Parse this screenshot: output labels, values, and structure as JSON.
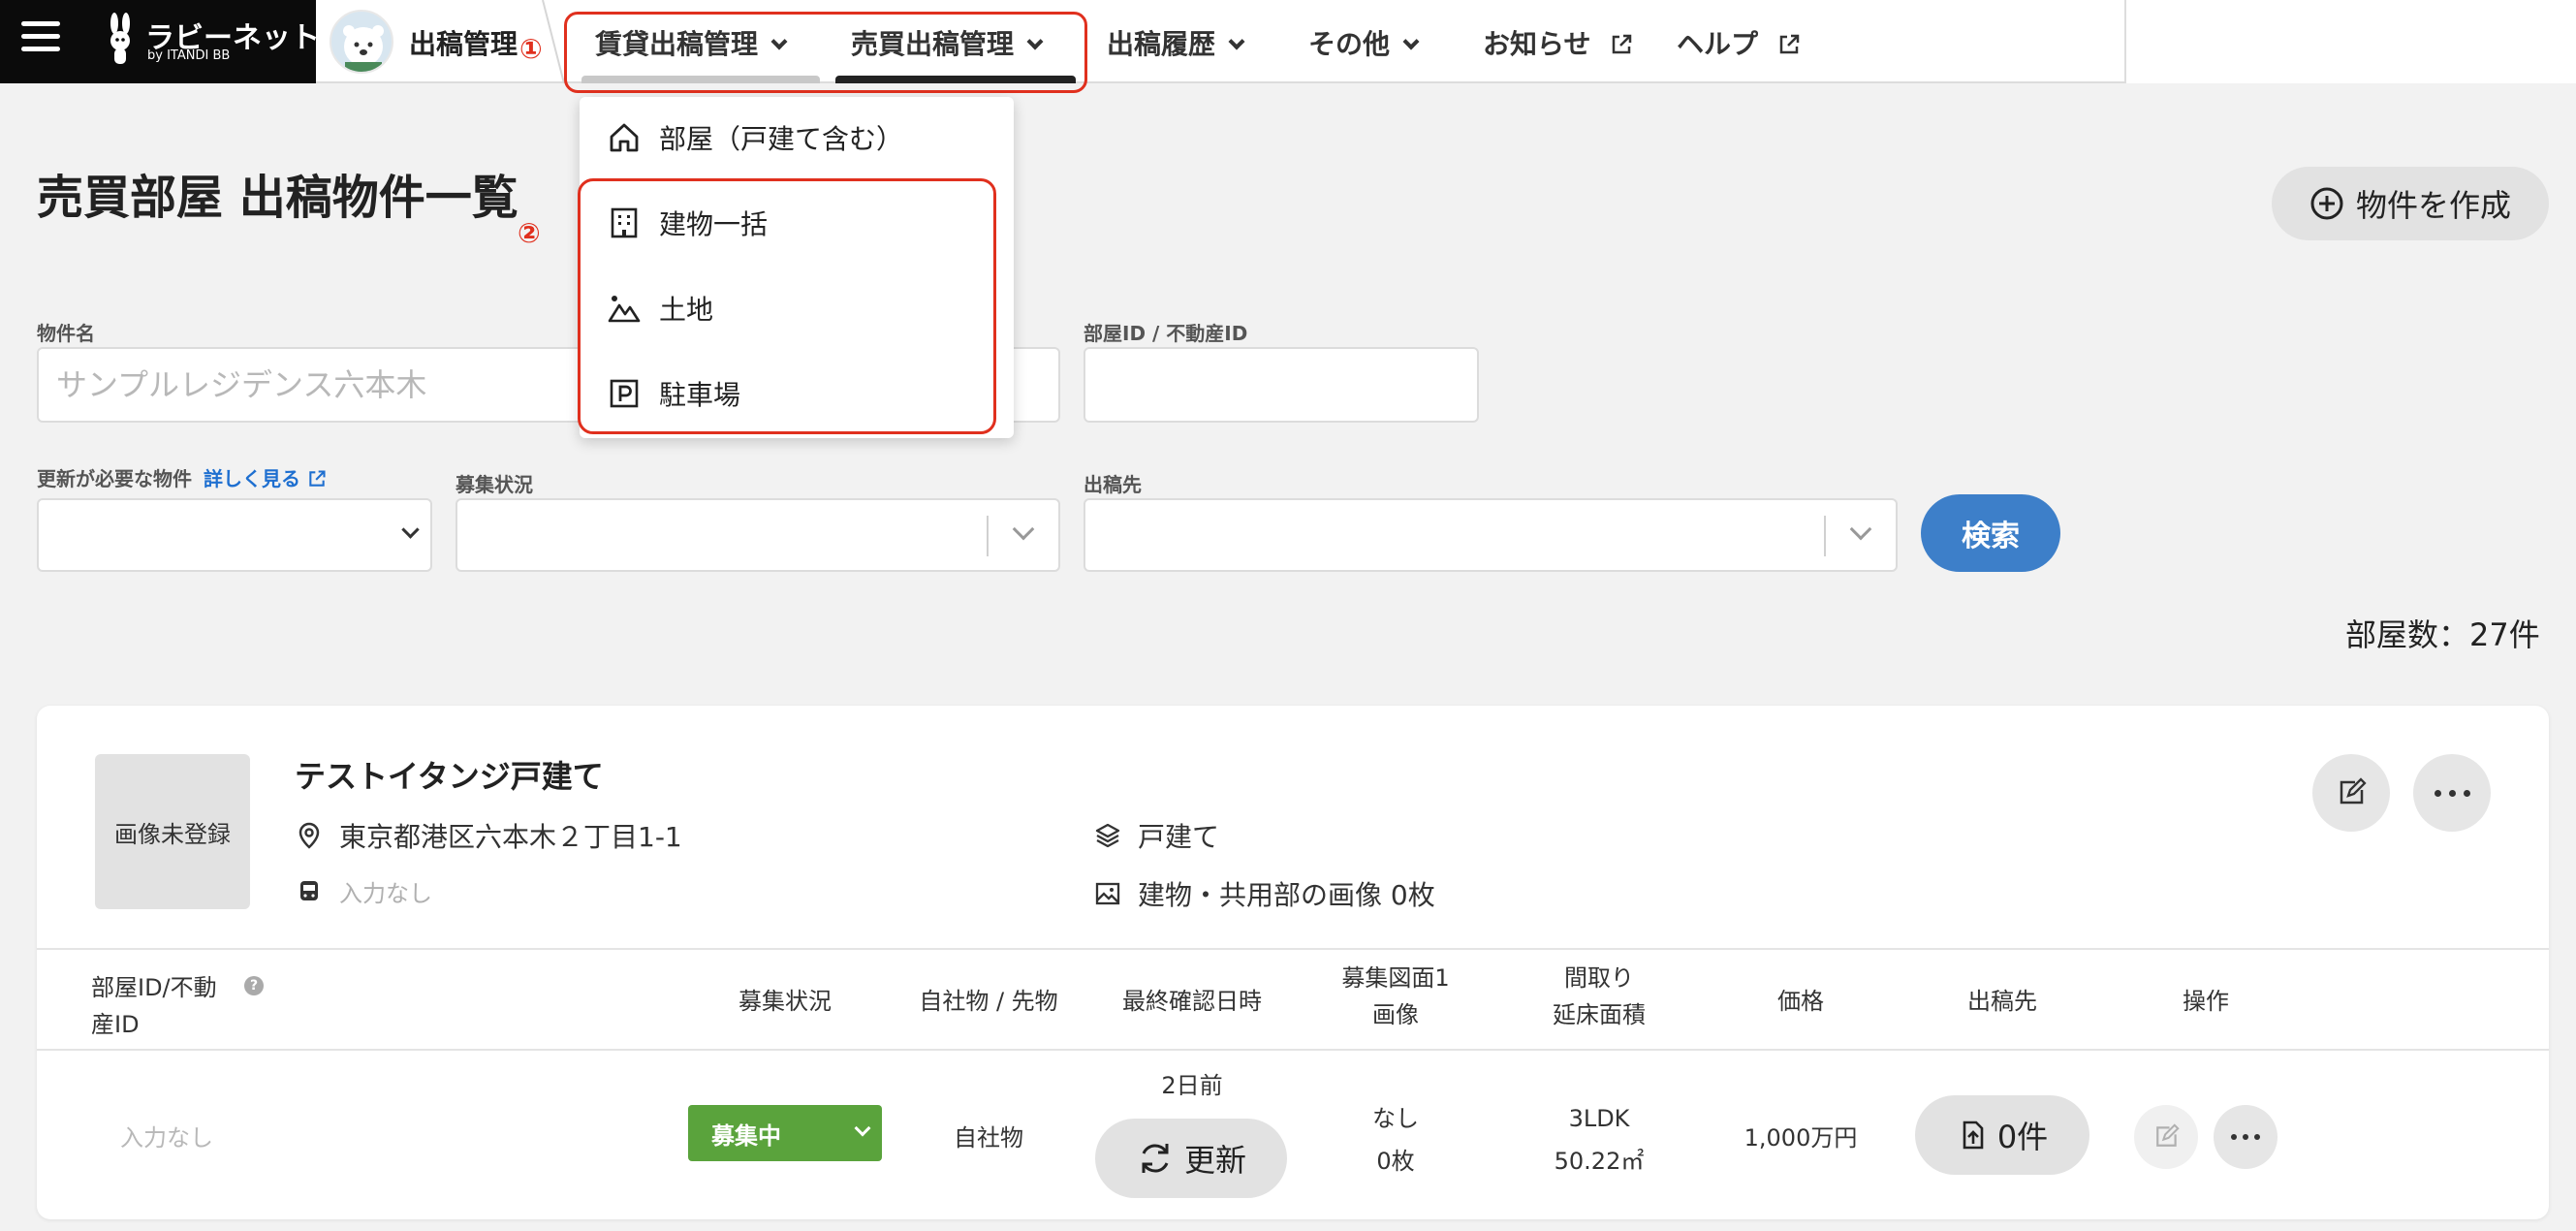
{
  "brand": {
    "name": "ラビーネットBB",
    "sub": "by ITANDI BB"
  },
  "app": {
    "name": "出稿管理"
  },
  "nav": {
    "items": [
      {
        "label": "賃貸出稿管理"
      },
      {
        "label": "売買出稿管理"
      },
      {
        "label": "出稿履歴"
      },
      {
        "label": "その他"
      },
      {
        "label": "お知らせ"
      },
      {
        "label": "ヘルプ"
      }
    ]
  },
  "annotations": {
    "one": "①",
    "two": "②"
  },
  "dropdown": {
    "items": [
      {
        "label": "部屋（戸建て含む）",
        "icon": "house-icon"
      },
      {
        "label": "建物一括",
        "icon": "building-icon"
      },
      {
        "label": "土地",
        "icon": "land-icon"
      },
      {
        "label": "駐車場",
        "icon": "parking-icon"
      }
    ]
  },
  "page": {
    "title": "売買部屋 出稿物件一覧",
    "create_button": "物件を作成",
    "room_count": "部屋数：27件"
  },
  "filters": {
    "property_name_label": "物件名",
    "property_name_placeholder": "サンプルレジデンス六本木",
    "room_id_label": "部屋ID / 不動産ID",
    "needs_update_label": "更新が必要な物件",
    "details_link": "詳しく見る",
    "status_label": "募集状況",
    "destination_label": "出稿先",
    "search_button": "検索"
  },
  "property": {
    "thumb_text": "画像未登録",
    "name": "テストイタンジ戸建て",
    "address": "東京都港区六本木２丁目1-1",
    "station": "入力なし",
    "type": "戸建て",
    "images": "建物・共用部の画像 0枚"
  },
  "table": {
    "headers": {
      "room_id_line1": "部屋ID/不動",
      "room_id_line2": "産ID",
      "help": "?",
      "status": "募集状況",
      "ownership": "自社物 / 先物",
      "last_confirmed": "最終確認日時",
      "plan_image_line1": "募集図面1",
      "plan_image_line2": "画像",
      "layout_line1": "間取り",
      "layout_line2": "延床面積",
      "price": "価格",
      "destination": "出稿先",
      "actions": "操作"
    },
    "row": {
      "room_id": "入力なし",
      "status": "募集中",
      "ownership": "自社物",
      "last_confirmed": "2日前",
      "refresh_button": "更新",
      "plan_image_line1": "なし",
      "plan_image_line2": "0枚",
      "layout": "3LDK",
      "area": "50.22㎡",
      "price": "1,000万円",
      "destination_count": "0件"
    }
  },
  "colors": {
    "accent_blue": "#3d7fc9",
    "status_green": "#5aa33c",
    "annotation_red": "#e0301e",
    "nav_black": "#0b0b0b"
  }
}
